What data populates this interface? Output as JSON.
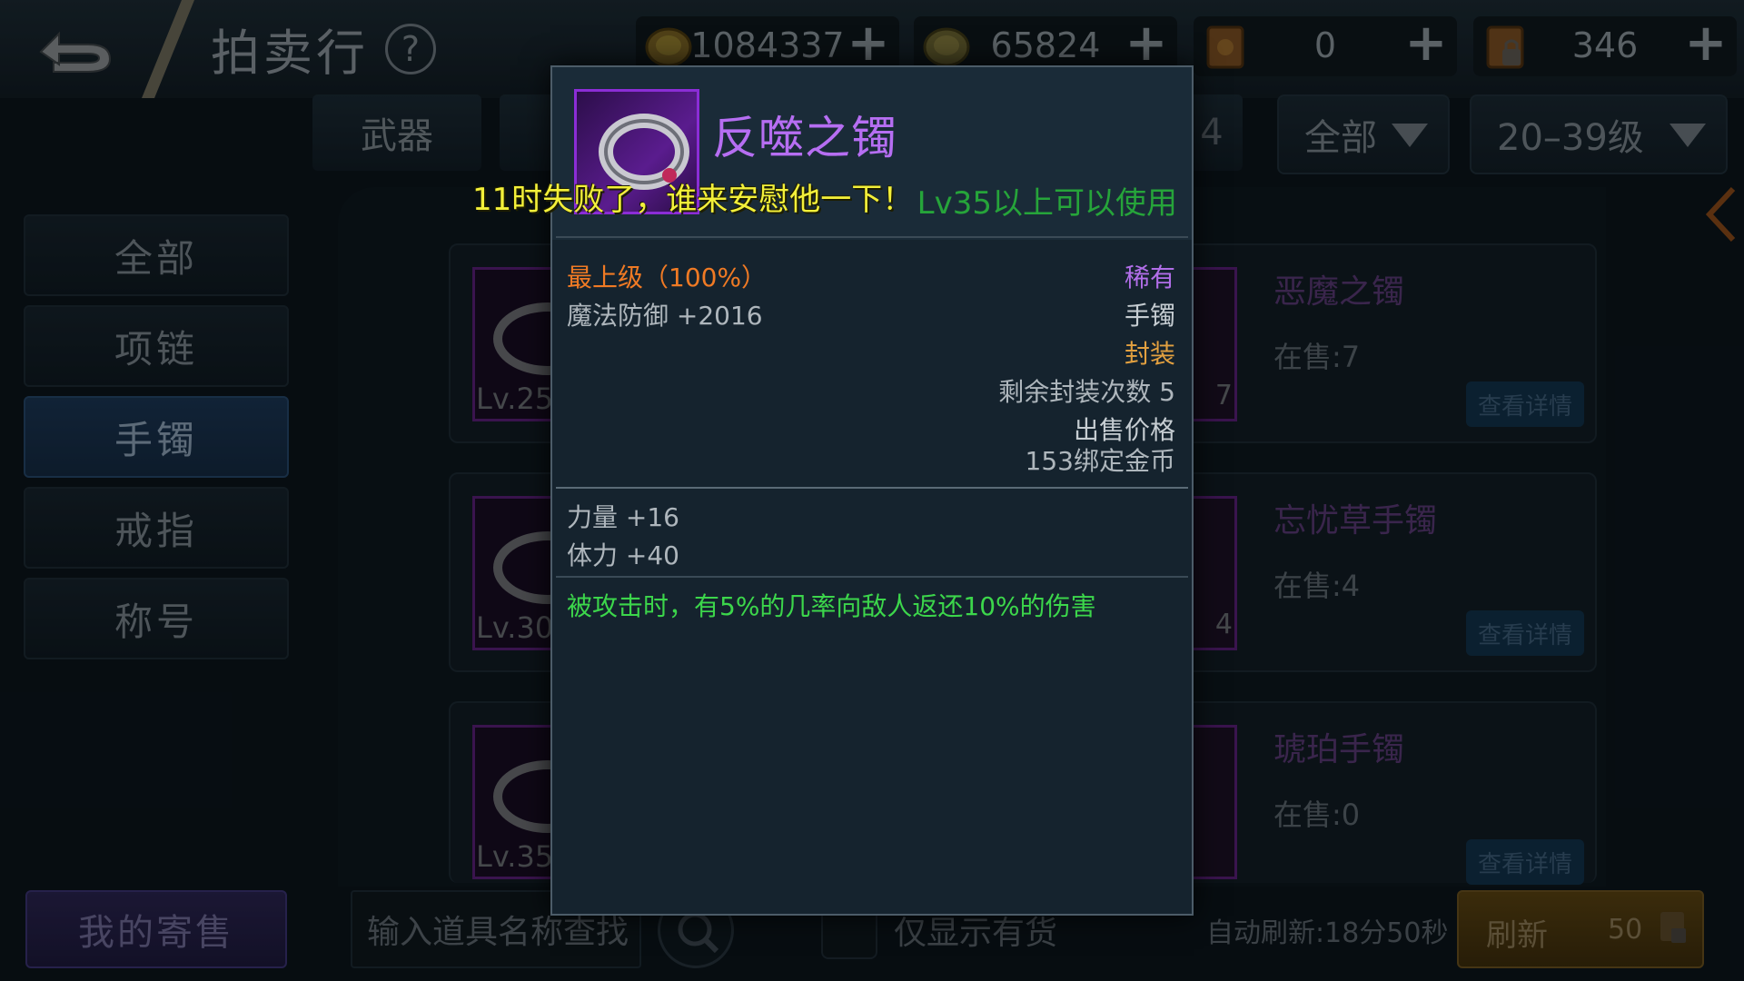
{
  "header": {
    "title": "拍卖行",
    "help": "?",
    "currencies": [
      {
        "icon": "gold-coin-icon",
        "value": "1084337"
      },
      {
        "icon": "bound-coin-icon",
        "value": "65824"
      },
      {
        "icon": "scroll-icon",
        "value": "0"
      },
      {
        "icon": "locked-scroll-icon",
        "value": "346"
      }
    ],
    "plus": "+"
  },
  "filters": {
    "category_tab": "武器",
    "partial_tab": "4",
    "type_dropdown": "全部",
    "level_dropdown": "20–39级"
  },
  "sidebar": {
    "items": [
      {
        "label": "全部"
      },
      {
        "label": "项链"
      },
      {
        "label": "手镯"
      },
      {
        "label": "戒指"
      },
      {
        "label": "称号"
      }
    ]
  },
  "listings": [
    {
      "level": "Lv.25",
      "right_count": "7",
      "name": "恶魔之镯",
      "stock": "在售:7",
      "detail": "查看详情"
    },
    {
      "level": "Lv.30",
      "right_count": "4",
      "name": "忘忧草手镯",
      "stock": "在售:4",
      "detail": "查看详情"
    },
    {
      "level": "Lv.35",
      "right_count": "",
      "name": "琥珀手镯",
      "stock": "在售:0",
      "detail": "查看详情"
    }
  ],
  "bottom": {
    "my_sale": "我的寄售",
    "search_placeholder": "输入道具名称查找",
    "stock_only": "仅显示有货",
    "auto_refresh": "自动刷新:18分50秒",
    "refresh": "刷新",
    "refresh_cost": "50"
  },
  "tooltip": {
    "item_name": "反噬之镯",
    "level_requirement": "Lv35以上可以使用",
    "quality": "最上级（100%）",
    "rarity": "稀有",
    "magic_defense": "魔法防御 +2016",
    "slot": "手镯",
    "sealed": "封装",
    "seal_remaining": "剩余封装次数 5",
    "price_label": "出售价格",
    "price": "153绑定金币",
    "strength": "力量 +16",
    "stamina": "体力 +40",
    "effect": "被攻击时，有5%的几率向敌人返还10%的伤害"
  },
  "chat_overlay": "11时失败了，谁来安慰他一下！",
  "colors": {
    "rarity_purple": "#b66ef2",
    "quality_orange": "#f07a24",
    "effect_green": "#3cd64b",
    "seal_gold": "#e2a040",
    "chat_yellow": "#f3f03a"
  }
}
